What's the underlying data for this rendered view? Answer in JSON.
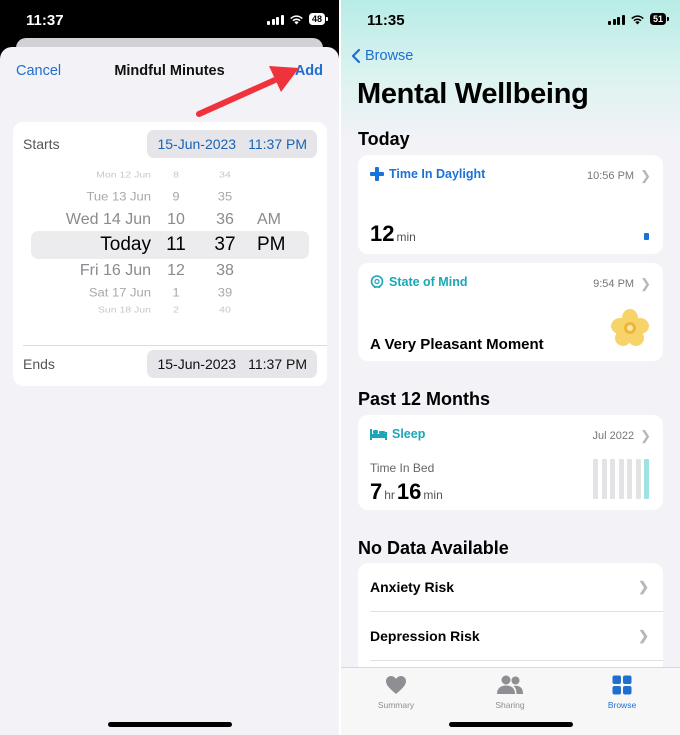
{
  "left": {
    "status": {
      "time": "11:37",
      "battery": "48"
    },
    "nav": {
      "cancel": "Cancel",
      "title": "Mindful Minutes",
      "add": "Add"
    },
    "starts": {
      "label": "Starts",
      "date": "15-Jun-2023",
      "time": "11:37 PM"
    },
    "ends": {
      "label": "Ends",
      "date": "15-Jun-2023",
      "time": "11:37 PM"
    },
    "picker_rows": [
      {
        "day": "Mon 12 Jun",
        "hour": "8",
        "minute": "34",
        "ampm": ""
      },
      {
        "day": "Tue 13 Jun",
        "hour": "9",
        "minute": "35",
        "ampm": ""
      },
      {
        "day": "Wed 14 Jun",
        "hour": "10",
        "minute": "36",
        "ampm": "AM"
      },
      {
        "day": "Today",
        "hour": "11",
        "minute": "37",
        "ampm": "PM"
      },
      {
        "day": "Fri 16 Jun",
        "hour": "12",
        "minute": "38",
        "ampm": ""
      },
      {
        "day": "Sat 17 Jun",
        "hour": "1",
        "minute": "39",
        "ampm": ""
      },
      {
        "day": "Sun 18 Jun",
        "hour": "2",
        "minute": "40",
        "ampm": ""
      }
    ],
    "arrow_color": "#f0323c"
  },
  "right": {
    "status": {
      "time": "11:35",
      "battery": "51"
    },
    "back_label": "Browse",
    "title": "Mental Wellbeing",
    "today_header": "Today",
    "daylight": {
      "title": "Time In Daylight",
      "time": "10:56 PM",
      "value": "12",
      "unit": "min"
    },
    "state_of_mind": {
      "title": "State of Mind",
      "time": "9:54 PM",
      "value": "A Very Pleasant Moment"
    },
    "past_header": "Past 12 Months",
    "sleep": {
      "title": "Sleep",
      "date": "Jul 2022",
      "label": "Time In Bed",
      "hours": "7",
      "hours_unit": "hr",
      "minutes": "16",
      "minutes_unit": "min",
      "bar_levels": [
        1,
        1,
        1,
        1,
        1,
        1,
        1
      ]
    },
    "no_data_header": "No Data Available",
    "no_data_items": [
      "Anxiety Risk",
      "Depression Risk"
    ],
    "tabs": [
      {
        "label": "Summary",
        "icon": "heart-icon",
        "active": false
      },
      {
        "label": "Sharing",
        "icon": "people-icon",
        "active": false
      },
      {
        "label": "Browse",
        "icon": "grid-icon",
        "active": true
      }
    ],
    "colors": {
      "accent": "#1e6fd0",
      "teal": "#1aa6b7",
      "daylight": "#1a73d6"
    }
  }
}
